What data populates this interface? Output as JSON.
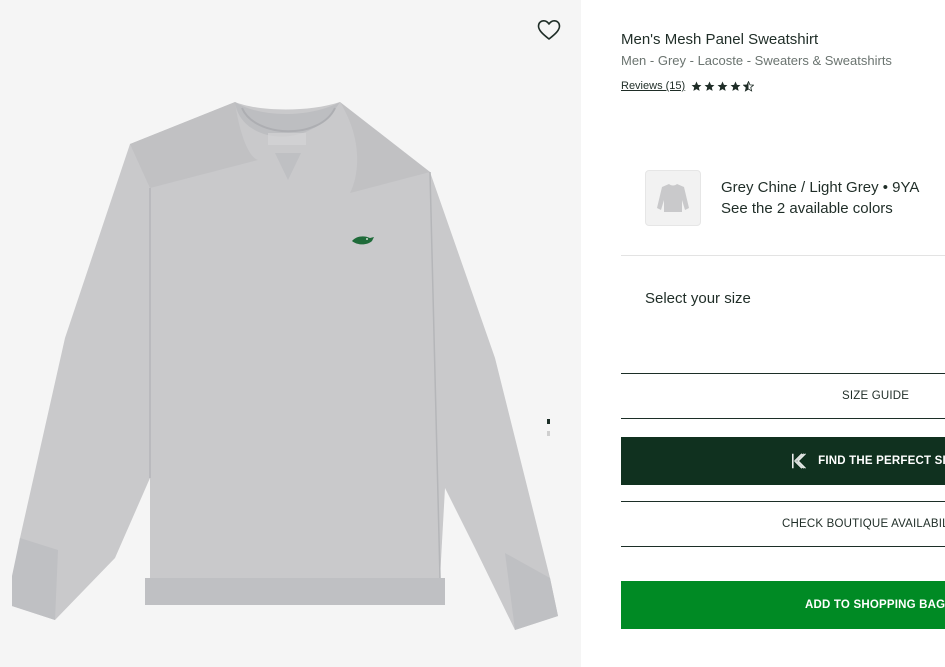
{
  "product": {
    "title": "Men's Mesh Panel Sweatshirt",
    "breadcrumb": "Men - Grey - Lacoste - Sweaters & Sweatshirts",
    "reviews_label": "Reviews (15)",
    "rating": 4.5,
    "rating_max": 5,
    "image_alt": "Grey crew neck sweatshirt with mesh shoulder panels"
  },
  "color": {
    "name": "Grey Chine / Light Grey • 9YA",
    "link": "See the 2 available colors"
  },
  "size": {
    "label": "Select your size"
  },
  "buttons": {
    "size_guide": "SIZE GUIDE",
    "find_size": "FIND THE PERFECT SIZE",
    "boutique": "CHECK BOUTIQUE AVAILABILITY",
    "add_to_bag": "ADD TO SHOPPING BAG"
  },
  "gallery": {
    "slides": 2,
    "active": 1
  },
  "colors": {
    "dark_green": "#10311f",
    "add_green": "#008a24",
    "text": "#1f2d27",
    "muted": "#6b7470",
    "gallery_bg": "#f5f5f5"
  },
  "icons": [
    "heart-icon",
    "star-icon",
    "half-star-icon",
    "kiwi-logo-icon",
    "sweatshirt-thumbnail"
  ]
}
